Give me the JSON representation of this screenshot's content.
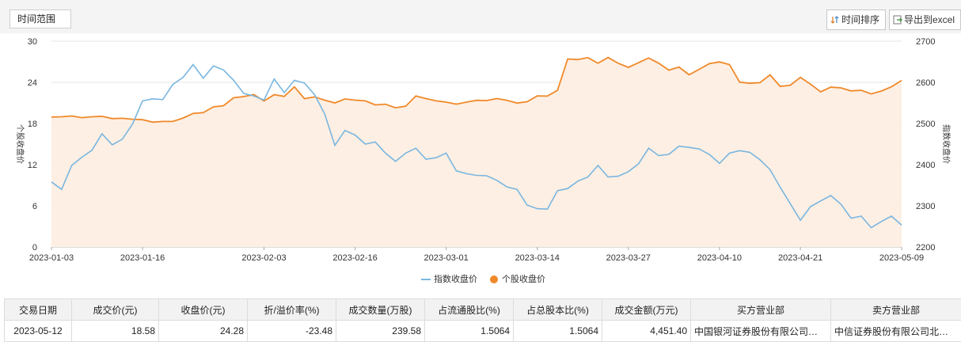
{
  "toolbar": {
    "range_label": "时间范围",
    "sort_label": "时间排序",
    "export_label": "导出到excel"
  },
  "colors": {
    "index_line": "#7ab6e0",
    "stock_line": "#f0892a",
    "stock_fill": "#fdeee2",
    "grid": "#e6e6e6"
  },
  "chart_data": {
    "type": "line",
    "x_ticks": [
      "2023-01-03",
      "2023-01-16",
      "2023-02-03",
      "2023-02-16",
      "2023-03-01",
      "2023-03-14",
      "2023-03-27",
      "2023-04-10",
      "2023-04-21",
      "2023-05-09"
    ],
    "y_left": {
      "label": "个股收盘价",
      "ticks": [
        0,
        6,
        12,
        18,
        24,
        30
      ],
      "ylim": [
        0,
        30
      ]
    },
    "y_right": {
      "label": "指数收盘价",
      "ticks": [
        2200,
        2300,
        2400,
        2500,
        2600,
        2700
      ],
      "ylim": [
        2200,
        2700
      ]
    },
    "legend_position": "bottom-center",
    "grid": true,
    "series": [
      {
        "name": "指数收盘价",
        "axis": "right",
        "values": [
          2358,
          2340,
          2398,
          2418,
          2435,
          2475,
          2448,
          2462,
          2498,
          2555,
          2560,
          2558,
          2595,
          2612,
          2643,
          2610,
          2640,
          2630,
          2605,
          2573,
          2567,
          2557,
          2608,
          2575,
          2605,
          2598,
          2570,
          2523,
          2447,
          2483,
          2472,
          2450,
          2455,
          2428,
          2408,
          2428,
          2440,
          2413,
          2417,
          2428,
          2385,
          2378,
          2374,
          2373,
          2362,
          2346,
          2340,
          2302,
          2293,
          2292,
          2337,
          2342,
          2360,
          2370,
          2398,
          2370,
          2372,
          2383,
          2402,
          2440,
          2422,
          2425,
          2445,
          2442,
          2438,
          2425,
          2403,
          2428,
          2434,
          2430,
          2412,
          2388,
          2345,
          2305,
          2265,
          2298,
          2312,
          2325,
          2304,
          2270,
          2275,
          2247,
          2262,
          2275,
          2253
        ]
      },
      {
        "name": "个股收盘价",
        "axis": "left",
        "values": [
          18.95,
          18.98,
          19.1,
          18.85,
          18.98,
          19.05,
          18.72,
          18.76,
          18.62,
          18.55,
          18.2,
          18.3,
          18.3,
          18.8,
          19.48,
          19.58,
          20.42,
          20.6,
          21.75,
          21.92,
          22.22,
          21.28,
          22.2,
          21.95,
          23.34,
          21.62,
          21.88,
          21.4,
          21.0,
          21.58,
          21.4,
          21.3,
          20.71,
          20.81,
          20.3,
          20.52,
          22.02,
          21.63,
          21.3,
          21.11,
          20.82,
          21.12,
          21.38,
          21.35,
          21.64,
          21.38,
          20.98,
          21.17,
          22.03,
          21.99,
          22.85,
          27.4,
          27.32,
          27.6,
          26.78,
          27.62,
          26.77,
          26.18,
          26.86,
          27.55,
          26.79,
          25.78,
          26.22,
          25.11,
          25.9,
          26.74,
          26.98,
          26.58,
          24.02,
          23.86,
          23.95,
          25.1,
          23.4,
          23.58,
          24.73,
          23.73,
          22.61,
          23.3,
          23.19,
          22.75,
          22.85,
          22.31,
          22.73,
          23.35,
          24.28
        ]
      }
    ]
  },
  "legend": {
    "index_label": "指数收盘价",
    "stock_label": "个股收盘价"
  },
  "table": {
    "headers": [
      "交易日期",
      "成交价(元)",
      "收盘价(元)",
      "折/溢价率(%)",
      "成交数量(万股)",
      "占流通股比(%)",
      "占总股本比(%)",
      "成交金额(万元)",
      "买方营业部",
      "卖方营业部"
    ],
    "rows": [
      [
        "2023-05-12",
        "18.58",
        "24.28",
        "-23.48",
        "239.58",
        "1.5064",
        "1.5064",
        "4,451.40",
        "中国银河证券股份有限公司北京中关村大街证券营业部",
        "中信证券股份有限公司北京总部证券营业部"
      ]
    ]
  }
}
